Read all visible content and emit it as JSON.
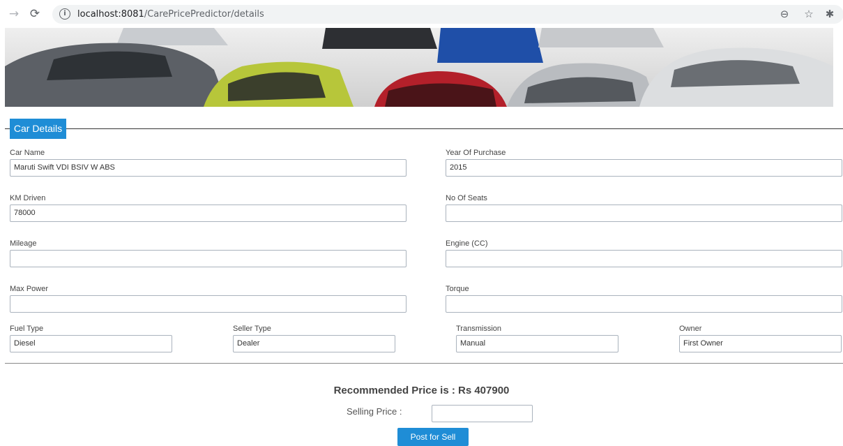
{
  "browser": {
    "url_host": "localhost:8081",
    "url_path": "/CarePricePredictor/details"
  },
  "section": {
    "title": "Car Details"
  },
  "fields": {
    "car_name": {
      "label": "Car Name",
      "value": "Maruti Swift VDI BSIV W ABS"
    },
    "year_of_purchase": {
      "label": "Year Of Purchase",
      "value": "2015"
    },
    "km_driven": {
      "label": "KM Driven",
      "value": "78000"
    },
    "no_of_seats": {
      "label": "No Of Seats",
      "value": ""
    },
    "mileage": {
      "label": "Mileage",
      "value": ""
    },
    "engine": {
      "label": "Engine (CC)",
      "value": ""
    },
    "max_power": {
      "label": "Max Power",
      "value": ""
    },
    "torque": {
      "label": "Torque",
      "value": ""
    },
    "fuel_type": {
      "label": "Fuel Type",
      "value": "Diesel"
    },
    "seller_type": {
      "label": "Seller Type",
      "value": "Dealer"
    },
    "transmission": {
      "label": "Transmission",
      "value": "Manual"
    },
    "owner": {
      "label": "Owner",
      "value": "First Owner"
    }
  },
  "result": {
    "recommended_text": "Recommended Price is : Rs 407900",
    "selling_price_label": "Selling Price :",
    "selling_price_value": "",
    "post_button": "Post for Sell"
  },
  "colors": {
    "accent": "#1f8dd6"
  }
}
